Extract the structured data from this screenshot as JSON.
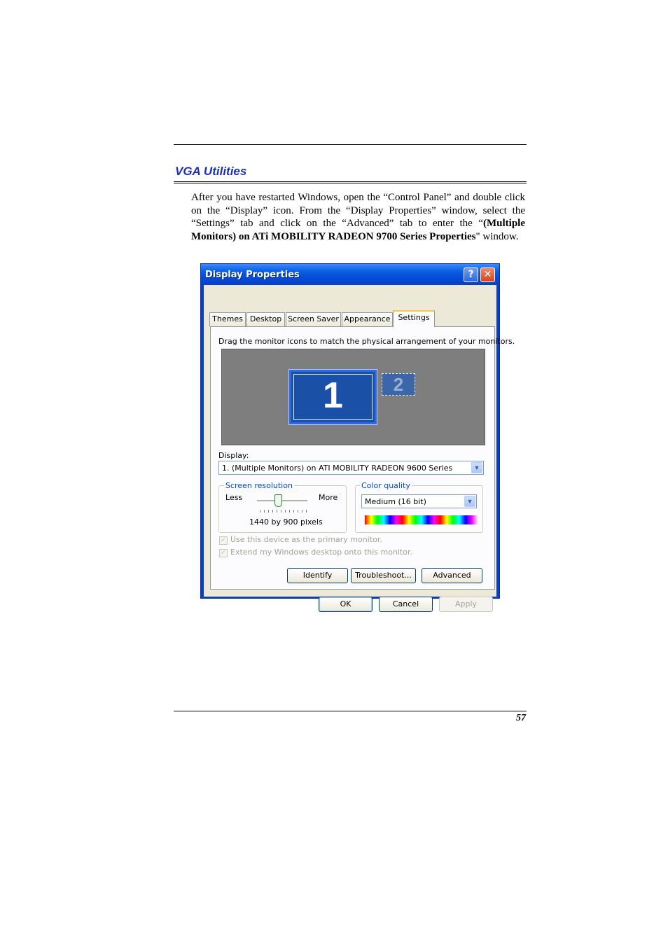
{
  "document": {
    "heading": "VGA Utilities",
    "paragraph_html": "After you have restarted Windows, open the “Control Panel” and double click on the “Display” icon. From the “Display Properties” window, select the “Settings” tab and click on the “Advanced” tab to enter the “<b>(Multiple Monitors) on ATi MOBILITY RADEON 9700 Series Properties</b>\" window.",
    "page_number": "57"
  },
  "dialog": {
    "title": "Display Properties",
    "help_glyph": "?",
    "close_glyph": "✕",
    "tabs": [
      "Themes",
      "Desktop",
      "Screen Saver",
      "Appearance",
      "Settings"
    ],
    "active_tab": "Settings",
    "instruction": "Drag the monitor icons to match the physical arrangement of your monitors.",
    "monitor_1": "1",
    "monitor_2": "2",
    "display_label": "Display:",
    "display_value": "1. (Multiple Monitors) on ATI MOBILITY RADEON 9600 Series",
    "screen_resolution": {
      "legend": "Screen resolution",
      "less": "Less",
      "more": "More",
      "value": "1440 by 900 pixels"
    },
    "color_quality": {
      "legend": "Color quality",
      "value": "Medium (16 bit)"
    },
    "checkbox_primary": "Use this device as the primary monitor.",
    "checkbox_extend": "Extend my Windows desktop onto this monitor.",
    "buttons": {
      "identify": "Identify",
      "troubleshoot": "Troubleshoot...",
      "advanced": "Advanced",
      "ok": "OK",
      "cancel": "Cancel",
      "apply": "Apply"
    },
    "dropdown_arrow": "▼"
  }
}
